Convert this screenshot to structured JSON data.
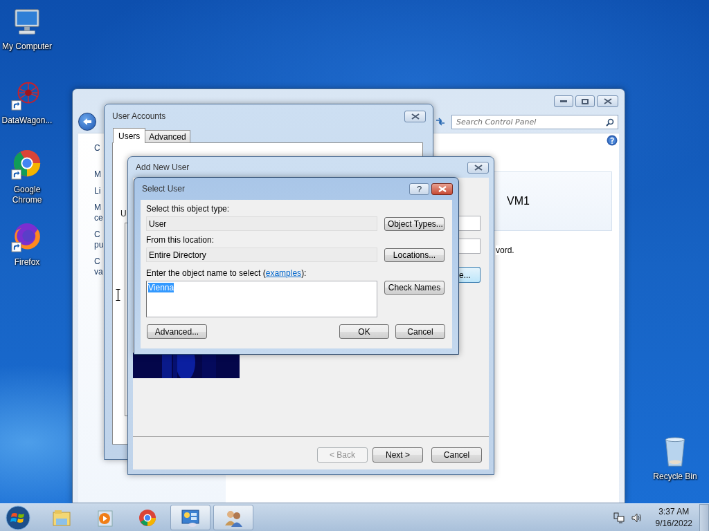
{
  "desktop_icons": [
    {
      "label": "My Computer",
      "kind": "computer",
      "shortcut": false
    },
    {
      "label": "DataWagon...",
      "kind": "datawagon",
      "shortcut": true
    },
    {
      "label": "Google Chrome",
      "kind": "chrome",
      "shortcut": true
    },
    {
      "label": "Firefox",
      "kind": "firefox",
      "shortcut": true
    }
  ],
  "recycle_bin": {
    "label": "Recycle Bin"
  },
  "control_panel": {
    "search": {
      "placeholder": "Search Control Panel"
    },
    "left_fragments": [
      "C",
      "M",
      "Li",
      "M\nce",
      "C\npu",
      "C\nva"
    ],
    "account_name": "VM1"
  },
  "user_accounts": {
    "title": "User Accounts",
    "tabs": [
      {
        "label": "Users",
        "selected": true
      },
      {
        "label": "Advanced",
        "selected": false
      }
    ],
    "fragment": "U"
  },
  "add_new_user": {
    "title": "Add New User",
    "fragment_text": "vord.",
    "fragment_button": "e...",
    "buttons": [
      {
        "label": "< Back",
        "disabled": true
      },
      {
        "label": "Next >",
        "disabled": false
      },
      {
        "label": "Cancel",
        "disabled": false
      }
    ]
  },
  "select_user": {
    "title": "Select User",
    "help": "?",
    "object_type_label": "Select this object type:",
    "object_type": "User",
    "object_types_button": "Object Types...",
    "location_label": "From this location:",
    "location": "Entire Directory",
    "locations_button": "Locations...",
    "name_label_before": "Enter the object name to select (",
    "name_link": "examples",
    "name_label_after": "):",
    "object_name": "Vienna",
    "text_selected": true,
    "check_names_button": "Check Names",
    "advanced_button": "Advanced...",
    "ok_button": "OK",
    "cancel_button": "Cancel"
  },
  "taskbar": {
    "items": [
      {
        "kind": "explorer",
        "active": false
      },
      {
        "kind": "media",
        "active": false
      },
      {
        "kind": "chrome",
        "active": false
      },
      {
        "kind": "control_panel",
        "active": true
      },
      {
        "kind": "users",
        "active": true
      }
    ],
    "time": "3:37 AM",
    "date": "9/16/2022"
  }
}
